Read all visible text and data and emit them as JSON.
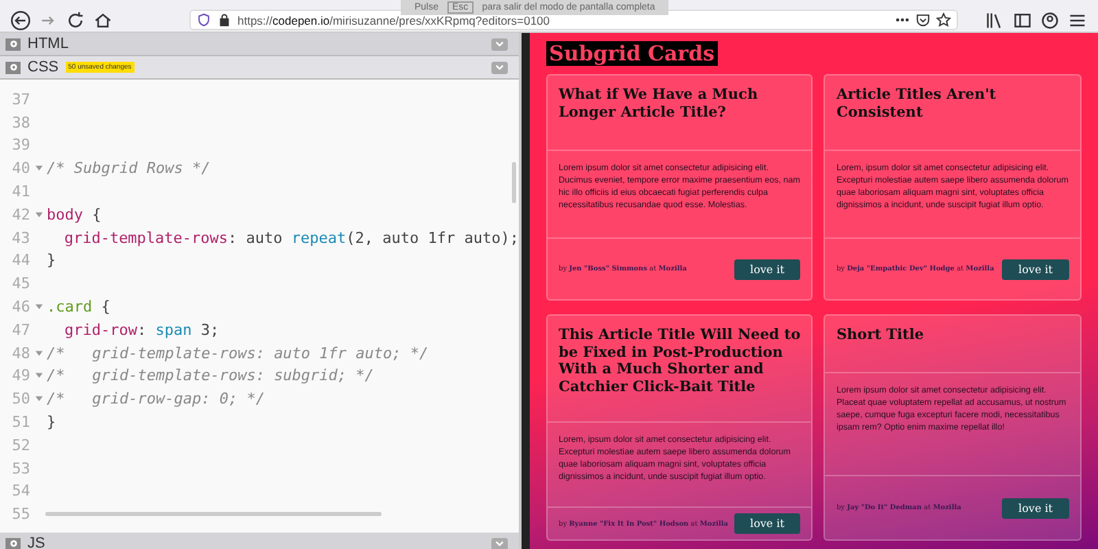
{
  "browser": {
    "url_prefix": "https://",
    "url_host": "codepen.io",
    "url_path": "/mirisuzanne/pres/xxKRpmq?editors=0100"
  },
  "fullscreen_notice": {
    "before": "Pulse",
    "key": "Esc",
    "after": "para salir del modo de pantalla completa"
  },
  "editor": {
    "panels": [
      {
        "name": "HTML",
        "expanded": false
      },
      {
        "name": "CSS",
        "expanded": true,
        "badge": "50 unsaved changes"
      },
      {
        "name": "JS",
        "expanded": false
      }
    ],
    "lines": [
      {
        "number": "37",
        "fold": false
      },
      {
        "number": "38",
        "fold": false
      },
      {
        "number": "39",
        "fold": false
      },
      {
        "number": "40",
        "fold": true,
        "tokens": [
          {
            "kind": "comment",
            "text": "/* Subgrid Rows */"
          }
        ]
      },
      {
        "number": "41",
        "fold": false
      },
      {
        "number": "42",
        "fold": true,
        "tokens": [
          {
            "kind": "tag",
            "text": "body"
          },
          {
            "kind": "plain",
            "text": " {"
          }
        ]
      },
      {
        "number": "43",
        "fold": false,
        "indent": true,
        "tokens": [
          {
            "kind": "property",
            "text": "grid-template-rows"
          },
          {
            "kind": "plain",
            "text": ": auto "
          },
          {
            "kind": "function",
            "text": "repeat"
          },
          {
            "kind": "plain",
            "text": "(2, auto 1fr auto);"
          }
        ]
      },
      {
        "number": "44",
        "fold": false,
        "tokens": [
          {
            "kind": "plain",
            "text": "}"
          }
        ]
      },
      {
        "number": "45",
        "fold": false
      },
      {
        "number": "46",
        "fold": true,
        "tokens": [
          {
            "kind": "selector",
            "text": ".card"
          },
          {
            "kind": "plain",
            "text": " {"
          }
        ]
      },
      {
        "number": "47",
        "fold": false,
        "indent": true,
        "tokens": [
          {
            "kind": "property",
            "text": "grid-row"
          },
          {
            "kind": "plain",
            "text": ": "
          },
          {
            "kind": "function",
            "text": "span"
          },
          {
            "kind": "plain",
            "text": " 3;"
          }
        ]
      },
      {
        "number": "48",
        "fold": true,
        "tokens": [
          {
            "kind": "comment",
            "text": "/*   grid-template-rows: auto 1fr auto; */"
          }
        ]
      },
      {
        "number": "49",
        "fold": true,
        "tokens": [
          {
            "kind": "comment",
            "text": "/*   grid-template-rows: subgrid; */"
          }
        ]
      },
      {
        "number": "50",
        "fold": true,
        "tokens": [
          {
            "kind": "comment",
            "text": "/*   grid-row-gap: 0; */"
          }
        ]
      },
      {
        "number": "51",
        "fold": false,
        "tokens": [
          {
            "kind": "plain",
            "text": "}"
          }
        ]
      },
      {
        "number": "52",
        "fold": false
      },
      {
        "number": "53",
        "fold": false
      },
      {
        "number": "54",
        "fold": false
      },
      {
        "number": "55",
        "fold": false
      }
    ]
  },
  "preview": {
    "title": "Subgrid Cards",
    "cards": [
      {
        "title": "What if We Have a Much Longer Article Title?",
        "body": "Lorem ipsum dolor sit amet consectetur adipisicing elit. Ducimus eveniet, tempore error maxime praesentium eos, nam hic illo officiis id eius obcaecati fugiat perferendis culpa necessitatibus recusandae quod esse. Molestias.",
        "byline": "by **Jen \"Boss\" Simmons** at **Mozilla**",
        "button": "love it"
      },
      {
        "title": "Article Titles Aren't Consistent",
        "body": "Lorem, ipsum dolor sit amet consectetur adipisicing elit. Excepturi molestiae autem saepe libero assumenda dolorum quae laboriosam aliquam magni sint, voluptates officia dignissimos a incidunt, unde suscipit fugiat illum optio.",
        "byline": "by **Deja \"Empathic Dev\" Hodge** at **Mozilla**",
        "button": "love it"
      },
      {
        "title": "This Article Title Will Need to be Fixed in Post-Production With a Much Shorter and Catchier Click-Bait Title",
        "body": "Lorem, ipsum dolor sit amet consectetur adipisicing elit. Excepturi molestiae autem saepe libero assumenda dolorum quae laboriosam aliquam magni sint, voluptates officia dignissimos a incidunt, unde suscipit fugiat illum optio.",
        "byline": "by **Ryanne \"Fix It In Post\" Hodson** at **Mozilla**",
        "button": "love it"
      },
      {
        "title": "Short Title",
        "body": "Lorem ipsum dolor sit amet consectetur adipisicing elit. Placeat quae voluptatem repellat ad accusamus, ut nostrum saepe, cumque fuga excepturi facere modi, necessitatibus ipsam rem? Optio enim maxime repellat illo!",
        "byline": "by **Jay \"Do It\" Dedman** at **Mozilla**",
        "button": "love it"
      }
    ]
  }
}
